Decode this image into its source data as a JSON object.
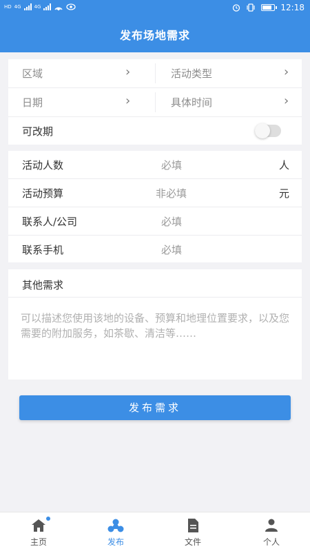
{
  "status_bar": {
    "network_label_1": "HD",
    "network_label_2": "4G",
    "network_label_3": "4G",
    "time": "12:18"
  },
  "header": {
    "title": "发布场地需求"
  },
  "card1": {
    "area_label": "区域",
    "activity_type_label": "活动类型",
    "date_label": "日期",
    "time_label": "具体时间",
    "changeable_label": "可改期",
    "changeable_on": false
  },
  "card2": {
    "people": {
      "label": "活动人数",
      "placeholder": "必填",
      "unit": "人"
    },
    "budget": {
      "label": "活动预算",
      "placeholder": "非必填",
      "unit": "元"
    },
    "contact": {
      "label": "联系人/公司",
      "placeholder": "必填"
    },
    "phone": {
      "label": "联系手机",
      "placeholder": "必填"
    }
  },
  "card3": {
    "title": "其他需求",
    "placeholder": "可以描述您使用该地的设备、预算和地理位置要求，以及您需要的附加服务，如茶歇、清洁等……"
  },
  "publish_button": "发布需求",
  "tabbar": {
    "items": [
      {
        "label": "主页",
        "icon": "home-icon",
        "badge": true
      },
      {
        "label": "发布",
        "icon": "publish-icon",
        "active": true
      },
      {
        "label": "文件",
        "icon": "file-icon"
      },
      {
        "label": "个人",
        "icon": "person-icon"
      }
    ]
  },
  "colors": {
    "primary": "#3c8ee5",
    "background": "#f2f2f5"
  }
}
